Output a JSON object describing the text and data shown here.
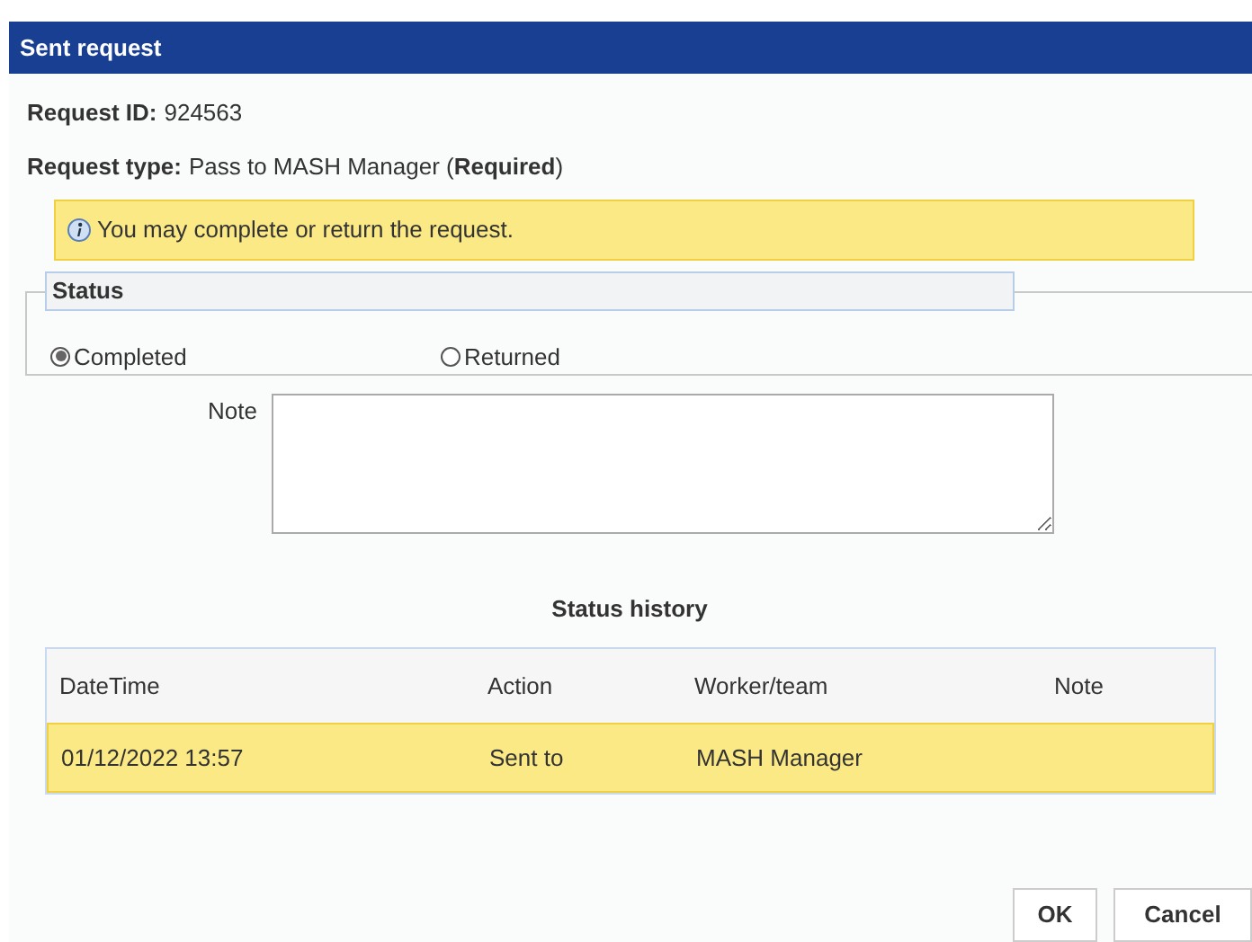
{
  "dialog": {
    "title": "Sent request"
  },
  "fields": [
    {
      "label": "Request ID:",
      "value": "924563"
    },
    {
      "label": "Request type:",
      "value": "Pass to MASH Manager (**Required**)"
    }
  ],
  "info": {
    "text": "You may complete or return the request."
  },
  "status": {
    "legend": "Status",
    "options": [
      {
        "label": "Completed",
        "selected": true
      },
      {
        "label": "Returned",
        "selected": false
      }
    ]
  },
  "note": {
    "label": "Note"
  },
  "history": {
    "title": "Status history",
    "columns": [
      "DateTime",
      "Action",
      "Worker/team",
      "Note"
    ],
    "rows": [
      {
        "cells": [
          "01/12/2022 13:57",
          "Sent to",
          "MASH Manager"
        ],
        "selected": true
      }
    ]
  },
  "buttons": [
    "OK",
    "Cancel"
  ]
}
